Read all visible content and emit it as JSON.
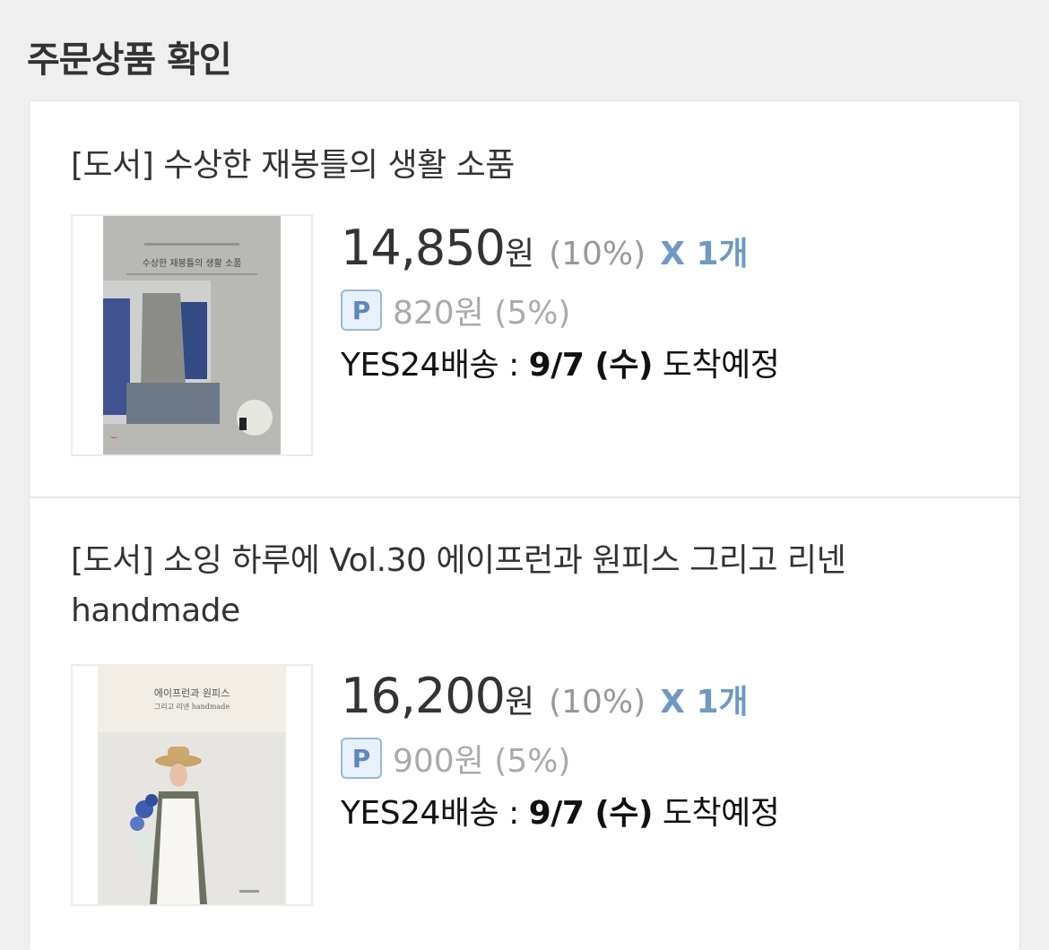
{
  "header": {
    "title": "주문상품 확인"
  },
  "items": [
    {
      "title": "[도서] 수상한 재봉틀의 생활 소품",
      "price": "14,850",
      "won": "원",
      "discount": "(10%)",
      "quantity": "X 1개",
      "points_badge": "P",
      "points": "820원 (5%)",
      "delivery_label": "YES24배송 : ",
      "delivery_date": "9/7 (수)",
      "delivery_suffix": " 도착예정",
      "cover_title": "수상한 재봉틀의 생활 소품"
    },
    {
      "title": "[도서] 소잉 하루에 Vol.30 에이프런과 원피스 그리고 리넨 handmade",
      "price": "16,200",
      "won": "원",
      "discount": "(10%)",
      "quantity": "X 1개",
      "points_badge": "P",
      "points": "900원 (5%)",
      "delivery_label": "YES24배송 : ",
      "delivery_date": "9/7 (수)",
      "delivery_suffix": " 도착예정",
      "cover_title": "에이프런과 원피스",
      "cover_subtitle": "그리고 리넨 handmade"
    }
  ]
}
